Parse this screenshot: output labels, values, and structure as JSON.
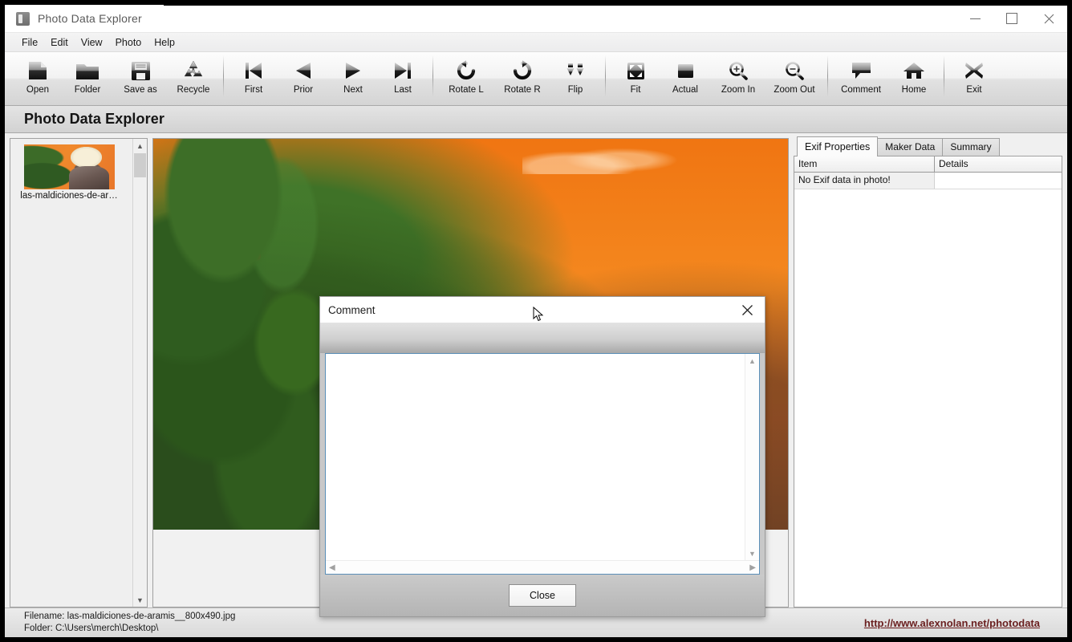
{
  "window": {
    "title": "Photo Data Explorer",
    "icon": "camera-icon",
    "controls": {
      "minimize": "minimize-icon",
      "maximize": "maximize-icon",
      "close": "close-icon"
    }
  },
  "menu": {
    "items": [
      {
        "label": "File"
      },
      {
        "label": "Edit"
      },
      {
        "label": "View"
      },
      {
        "label": "Photo"
      },
      {
        "label": "Help"
      }
    ]
  },
  "toolbar": {
    "groups": [
      {
        "buttons": [
          {
            "label": "Open",
            "icon": "document-icon"
          },
          {
            "label": "Folder",
            "icon": "folder-icon"
          },
          {
            "label": "Save as",
            "icon": "floppy-disk-icon"
          },
          {
            "label": "Recycle",
            "icon": "recycle-icon"
          }
        ]
      },
      {
        "buttons": [
          {
            "label": "First",
            "icon": "skip-back-icon"
          },
          {
            "label": "Prior",
            "icon": "play-back-icon"
          },
          {
            "label": "Next",
            "icon": "play-forward-icon"
          },
          {
            "label": "Last",
            "icon": "skip-forward-icon"
          }
        ]
      },
      {
        "buttons": [
          {
            "label": "Rotate L",
            "icon": "rotate-left-icon"
          },
          {
            "label": "Rotate R",
            "icon": "rotate-right-icon"
          },
          {
            "label": "Flip",
            "icon": "flip-down-arrows-icon"
          }
        ]
      },
      {
        "buttons": [
          {
            "label": "Fit",
            "icon": "fit-to-window-icon"
          },
          {
            "label": "Actual",
            "icon": "actual-size-icon"
          },
          {
            "label": "Zoom In",
            "icon": "magnifier-plus-icon"
          },
          {
            "label": "Zoom Out",
            "icon": "magnifier-minus-icon"
          }
        ]
      },
      {
        "buttons": [
          {
            "label": "Comment",
            "icon": "speech-bubble-icon"
          },
          {
            "label": "Home",
            "icon": "home-icon"
          }
        ]
      },
      {
        "buttons": [
          {
            "label": "Exit",
            "icon": "x-cross-icon"
          }
        ]
      }
    ]
  },
  "header": {
    "title": "Photo Data Explorer"
  },
  "thumbnails": {
    "items": [
      {
        "caption": "las-maldiciones-de-ar…"
      }
    ]
  },
  "right_panel": {
    "tabs": [
      {
        "label": "Exif Properties",
        "active": true
      },
      {
        "label": "Maker Data",
        "active": false
      },
      {
        "label": "Summary",
        "active": false
      }
    ],
    "grid": {
      "columns": [
        "Item",
        "Details"
      ],
      "rows": [
        {
          "item": "No Exif data in photo!",
          "details": ""
        }
      ]
    }
  },
  "status": {
    "filename_line": "Filename: las-maldiciones-de-aramis__800x490.jpg",
    "folder_line": "Folder: C:\\Users\\merch\\Desktop\\",
    "web_link": "http://www.alexnolan.net/photodata"
  },
  "dialog": {
    "title": "Comment",
    "close_icon": "close-icon",
    "textarea_value": "",
    "close_button": "Close"
  }
}
